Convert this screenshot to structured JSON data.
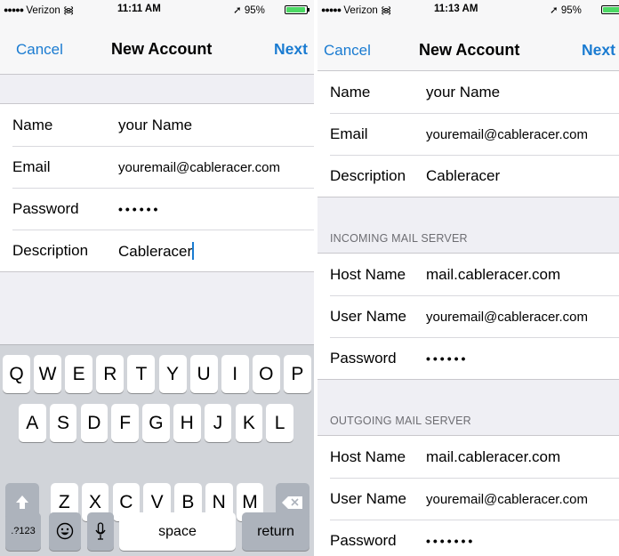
{
  "left": {
    "status": {
      "carrier": "Verizon",
      "time": "11:11 AM",
      "battery": "95%"
    },
    "nav": {
      "cancel": "Cancel",
      "title": "New Account",
      "next": "Next"
    },
    "fields": [
      {
        "label": "Name",
        "value": "your Name"
      },
      {
        "label": "Email",
        "value": "youremail@cableracer.com"
      },
      {
        "label": "Password",
        "value": "••••••"
      },
      {
        "label": "Description",
        "value": "Cableracer"
      }
    ]
  },
  "right": {
    "status": {
      "carrier": "Verizon",
      "time": "11:13 AM",
      "battery": "95%"
    },
    "nav": {
      "cancel": "Cancel",
      "title": "New Account",
      "next": "Next"
    },
    "fields": [
      {
        "label": "Name",
        "value": "your Name"
      },
      {
        "label": "Email",
        "value": "youremail@cableracer.com"
      },
      {
        "label": "Description",
        "value": "Cableracer"
      }
    ],
    "incoming": {
      "header": "INCOMING MAIL SERVER",
      "fields": [
        {
          "label": "Host Name",
          "value": "mail.cableracer.com"
        },
        {
          "label": "User Name",
          "value": "youremail@cableracer.com"
        },
        {
          "label": "Password",
          "value": "••••••"
        }
      ]
    },
    "outgoing": {
      "header": "OUTGOING MAIL SERVER",
      "fields": [
        {
          "label": "Host Name",
          "value": "mail.cableracer.com"
        },
        {
          "label": "User Name",
          "value": "youremail@cableracer.com"
        },
        {
          "label": "Password",
          "value": "•••••••"
        }
      ]
    }
  },
  "keyboard": {
    "row1": [
      "Q",
      "W",
      "E",
      "R",
      "T",
      "Y",
      "U",
      "I",
      "O",
      "P"
    ],
    "row2": [
      "A",
      "S",
      "D",
      "F",
      "G",
      "H",
      "J",
      "K",
      "L"
    ],
    "row3": [
      "Z",
      "X",
      "C",
      "V",
      "B",
      "N",
      "M"
    ],
    "numbers_key": ".?123",
    "space": "space",
    "return": "return",
    "icons": {
      "shift": "shift-icon",
      "delete": "delete-icon",
      "emoji": "emoji-icon",
      "mic": "microphone-icon"
    }
  },
  "colors": {
    "accent": "#1a7bd1",
    "background": "#efeff4",
    "keyboard": "#d1d4d9",
    "battery": "#4cd964"
  }
}
